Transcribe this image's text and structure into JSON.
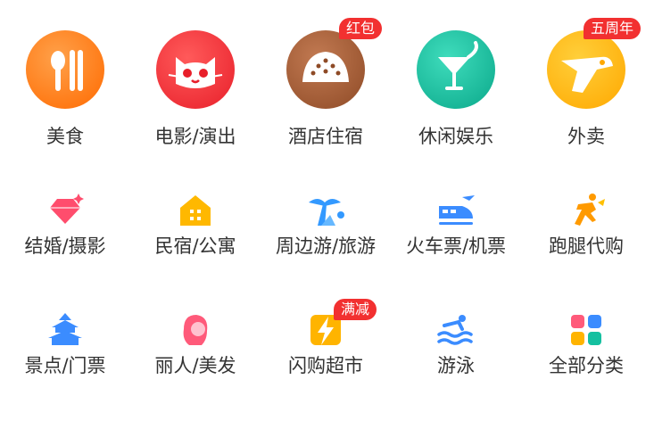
{
  "grid": {
    "row1": [
      {
        "label": "美食",
        "icon": "fork-knife-icon",
        "color": "#ff7a1a"
      },
      {
        "label": "电影/演出",
        "icon": "cat-face-icon",
        "color": "#f03a3a"
      },
      {
        "label": "酒店住宿",
        "icon": "pie-bun-icon",
        "color": "#a8603a",
        "badge": "红包"
      },
      {
        "label": "休闲娱乐",
        "icon": "cocktail-icon",
        "color": "#15c0a0"
      },
      {
        "label": "外卖",
        "icon": "delivery-dog-icon",
        "color": "#ffb400",
        "badge": "五周年"
      }
    ],
    "row2": [
      {
        "label": "结婚/摄影",
        "icon": "diamond-icon",
        "color": "#ff4d6d"
      },
      {
        "label": "民宿/公寓",
        "icon": "house-icon",
        "color": "#ffb800"
      },
      {
        "label": "周边游/旅游",
        "icon": "palm-tree-icon",
        "color": "#3399ff"
      },
      {
        "label": "火车票/机票",
        "icon": "train-plane-icon",
        "color": "#3b8cff"
      },
      {
        "label": "跑腿代购",
        "icon": "runner-icon",
        "color": "#ff9a00"
      }
    ],
    "row3": [
      {
        "label": "景点/门票",
        "icon": "temple-icon",
        "color": "#3b8cff"
      },
      {
        "label": "丽人/美发",
        "icon": "woman-hair-icon",
        "color": "#ff5a7a"
      },
      {
        "label": "闪购超市",
        "icon": "lightning-bag-icon",
        "color": "#ffb400",
        "badge": "满减"
      },
      {
        "label": "游泳",
        "icon": "swimmer-icon",
        "color": "#3b8cff"
      },
      {
        "label": "全部分类",
        "icon": "four-squares-icon",
        "color": "#ff5a7a"
      }
    ]
  }
}
